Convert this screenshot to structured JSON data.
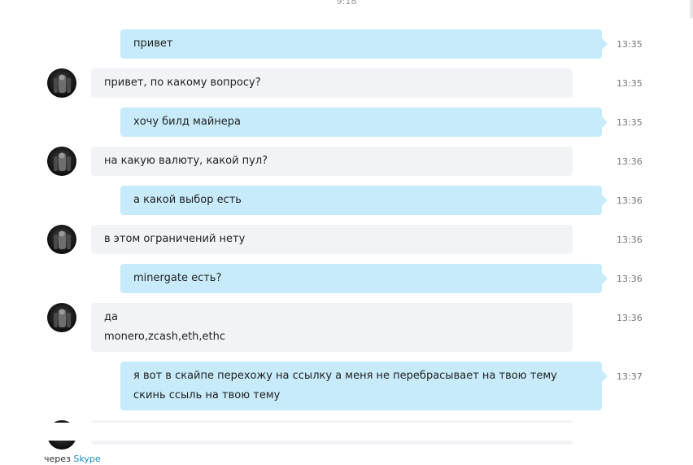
{
  "header": {
    "date_time": "9:18"
  },
  "messages": [
    {
      "side": "out",
      "lines": [
        "привет"
      ],
      "time": "13:35"
    },
    {
      "side": "in",
      "lines": [
        "привет, по какому вопросу?"
      ],
      "time": "13:35"
    },
    {
      "side": "out",
      "lines": [
        "хочу билд майнера"
      ],
      "time": "13:35"
    },
    {
      "side": "in",
      "lines": [
        "на какую валюту, какой пул?"
      ],
      "time": "13:36"
    },
    {
      "side": "out",
      "lines": [
        "а какой выбор есть"
      ],
      "time": "13:36"
    },
    {
      "side": "in",
      "lines": [
        "в этом ограничений нету"
      ],
      "time": "13:36"
    },
    {
      "side": "out",
      "lines": [
        "minergate есть?"
      ],
      "time": "13:36"
    },
    {
      "side": "in",
      "lines": [
        "да",
        "monero,zcash,eth,ethc"
      ],
      "time": "13:36"
    },
    {
      "side": "out",
      "lines": [
        "я вот в скайпе перехожу на ссылку а меня не перебрасывает на твою тему",
        "скинь ссыль на твою тему"
      ],
      "time": "13:37"
    }
  ],
  "footer": {
    "prefix": "через",
    "link": "Skype"
  }
}
